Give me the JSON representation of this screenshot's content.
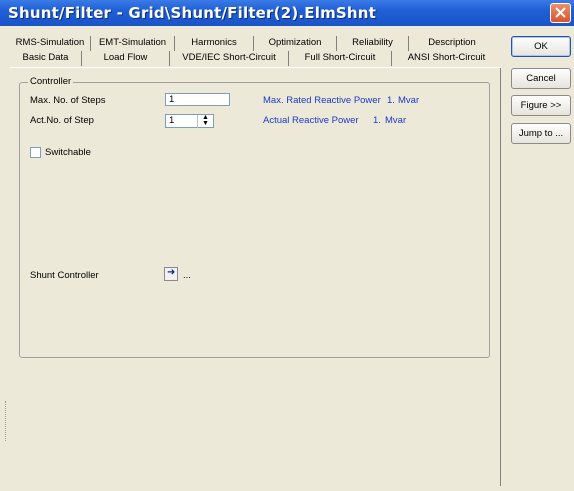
{
  "window": {
    "title": "Shunt/Filter - Grid\\Shunt/Filter(2).ElmShnt"
  },
  "tabs": {
    "row1": [
      "RMS-Simulation",
      "EMT-Simulation",
      "Harmonics",
      "Optimization",
      "Reliability",
      "Description"
    ],
    "row2": [
      "Basic Data",
      "Load Flow",
      "VDE/IEC Short-Circuit",
      "Full Short-Circuit",
      "ANSI Short-Circuit"
    ],
    "active": "Load Flow"
  },
  "controller": {
    "group_label": "Controller",
    "max_steps_label": "Max. No. of Steps",
    "max_steps_value": "1",
    "act_step_label": "Act.No. of Step",
    "act_step_value": "1",
    "max_rated_label": "Max. Rated Reactive Power",
    "max_rated_value": "1.",
    "max_rated_unit": "Mvar",
    "actual_label": "Actual Reactive Power",
    "actual_value": "1.",
    "actual_unit": "Mvar",
    "switchable_label": "Switchable",
    "switchable_checked": false,
    "shunt_controller_label": "Shunt Controller",
    "shunt_controller_value": "..."
  },
  "buttons": {
    "ok": "OK",
    "cancel": "Cancel",
    "figure": "Figure >>",
    "jump": "Jump to ..."
  },
  "colors": {
    "titlebar": "#1f5fd6",
    "link_blue": "#1c39c7",
    "face": "#ece9d8"
  }
}
